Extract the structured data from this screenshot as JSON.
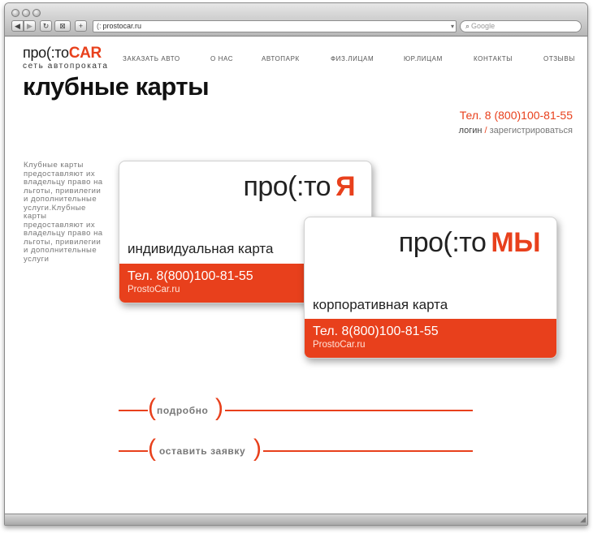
{
  "browser": {
    "url": "prostocar.ru",
    "search_placeholder": "Google"
  },
  "logo": {
    "main": "про(:то",
    "brand": "CAR",
    "subtitle": "сеть автопроката"
  },
  "nav": {
    "items": [
      {
        "label": "ЗАКАЗАТЬ АВТО"
      },
      {
        "label": "О НАС"
      },
      {
        "label": "АВТОПАРК"
      },
      {
        "label": "ФИЗ.ЛИЦАМ"
      },
      {
        "label": "ЮР.ЛИЦАМ"
      },
      {
        "label": "КОНТАКТЫ"
      },
      {
        "label": "ОТЗЫВЫ"
      }
    ]
  },
  "page": {
    "title": "клубные карты",
    "phone": "Тел. 8 (800)100-81-55",
    "login": "логин",
    "separator": "/",
    "register": "зарегистрироваться",
    "intro": "Клубные карты предоставляют их владельцу право на льготы, привилегии и дополнительные услуги.Клубные карты предоставляют их владельцу право на льготы, привилегии и дополнительные услуги"
  },
  "cards": [
    {
      "brand": "про(:то",
      "accent": "Я",
      "type": "индивидуальная карта",
      "phone": "Тел. 8(800)100-81-55",
      "site": "ProstoCar.ru"
    },
    {
      "brand": "про(:то",
      "accent": "МЫ",
      "type": "корпоративная карта",
      "phone": "Тел. 8(800)100-81-55",
      "site": "ProstoCar.ru"
    }
  ],
  "links": {
    "more": "подробно",
    "apply": "оставить заявку",
    "paren_open": "(",
    "paren_close": ")"
  },
  "colors": {
    "accent": "#e8401c",
    "text_gray": "#777777"
  },
  "icons": [
    "back-icon",
    "forward-icon",
    "reload-icon",
    "bookmark-icon",
    "add-icon",
    "favicon",
    "search-icon"
  ]
}
